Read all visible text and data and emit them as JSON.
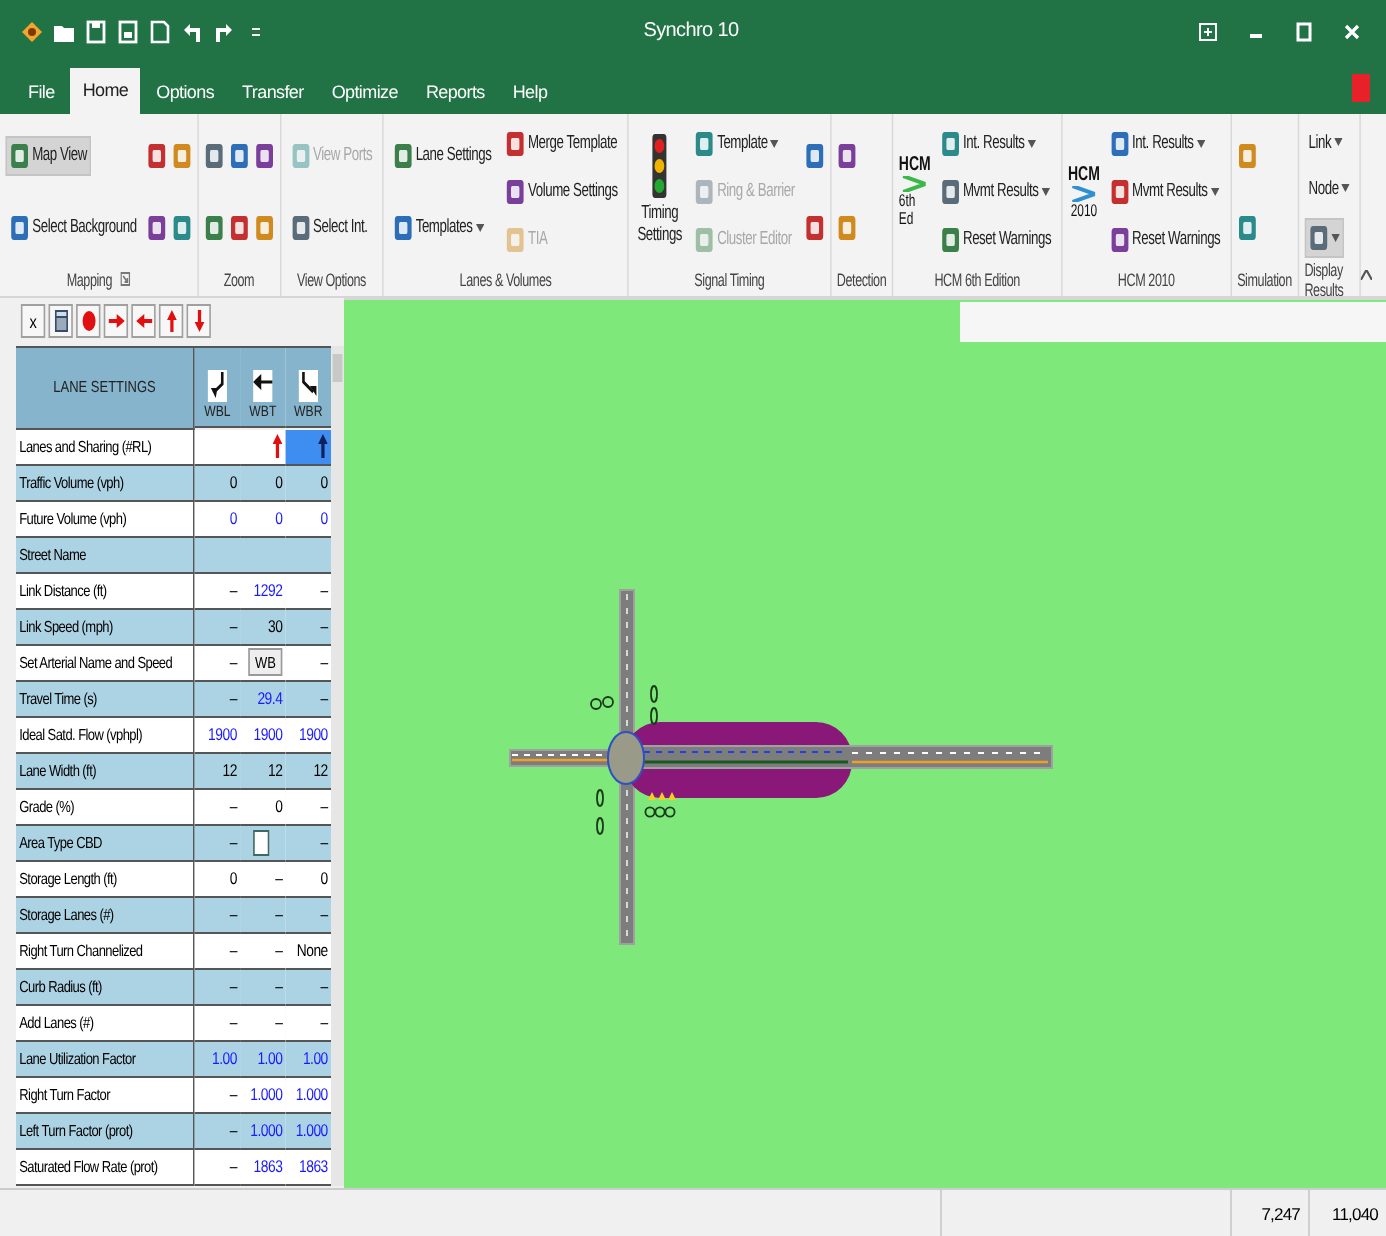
{
  "window": {
    "title": "Synchro 10"
  },
  "tabs": [
    {
      "label": "File",
      "selected": false
    },
    {
      "label": "Home",
      "selected": true
    },
    {
      "label": "Options",
      "selected": false
    },
    {
      "label": "Transfer",
      "selected": false
    },
    {
      "label": "Optimize",
      "selected": false
    },
    {
      "label": "Reports",
      "selected": false
    },
    {
      "label": "Help",
      "selected": false
    }
  ],
  "ribbon": {
    "groups": [
      {
        "label": "Mapping",
        "launcher": true,
        "columns": [
          [
            {
              "kind": "toggle",
              "label": "Map View",
              "active": true,
              "disabled": false
            },
            {
              "kind": "button",
              "label": "Select Background",
              "disabled": false
            }
          ],
          [
            {
              "kind": "icon"
            },
            {
              "kind": "icon"
            }
          ],
          [
            {
              "kind": "icon"
            },
            {
              "kind": "icon"
            }
          ]
        ]
      },
      {
        "label": "Zoom",
        "columns": [
          [
            {
              "kind": "icon"
            },
            {
              "kind": "icon"
            }
          ],
          [
            {
              "kind": "icon"
            },
            {
              "kind": "icon"
            }
          ],
          [
            {
              "kind": "icon"
            },
            {
              "kind": "icon"
            }
          ]
        ]
      },
      {
        "label": "View Options",
        "columns": [
          [
            {
              "kind": "button",
              "label": "View Ports",
              "disabled": true
            },
            {
              "kind": "button",
              "label": "Select Int.",
              "disabled": false
            }
          ]
        ]
      },
      {
        "label": "Lanes & Volumes",
        "columns": [
          [
            {
              "kind": "button",
              "label": "Lane Settings",
              "disabled": false
            },
            {
              "kind": "button",
              "label": "Templates",
              "disabled": false,
              "dropdown": true
            }
          ],
          [
            {
              "kind": "button",
              "label": "Merge Template",
              "disabled": false
            },
            {
              "kind": "button",
              "label": "Volume Settings",
              "disabled": false
            },
            {
              "kind": "button",
              "label": "TIA",
              "disabled": true
            }
          ]
        ]
      },
      {
        "label": "Signal Timing",
        "columns": [
          [
            {
              "kind": "large",
              "label": "Timing Settings"
            }
          ],
          [
            {
              "kind": "button",
              "label": "Template",
              "disabled": false,
              "dropdown": true
            },
            {
              "kind": "button",
              "label": "Ring & Barrier",
              "disabled": true
            },
            {
              "kind": "button",
              "label": "Cluster Editor",
              "disabled": true
            }
          ],
          [
            {
              "kind": "icon"
            },
            {
              "kind": "icon"
            }
          ]
        ]
      },
      {
        "label": "Detection",
        "columns": [
          [
            {
              "kind": "icon"
            },
            {
              "kind": "icon"
            }
          ]
        ]
      },
      {
        "label": "HCM 6th Edition",
        "columns": [
          [
            {
              "kind": "logo",
              "lines": [
                "HCM",
                "6th Ed"
              ]
            }
          ],
          [
            {
              "kind": "button",
              "label": "Int. Results",
              "disabled": false,
              "dropdown": true
            },
            {
              "kind": "button",
              "label": "Mvmt Results",
              "disabled": false,
              "dropdown": true
            },
            {
              "kind": "button",
              "label": "Reset Warnings",
              "disabled": false
            }
          ]
        ]
      },
      {
        "label": "HCM 2010",
        "columns": [
          [
            {
              "kind": "logo",
              "lines": [
                "HCM",
                "2010"
              ]
            }
          ],
          [
            {
              "kind": "button",
              "label": "Int. Results",
              "disabled": false,
              "dropdown": true
            },
            {
              "kind": "button",
              "label": "Mvmt Results",
              "disabled": false,
              "dropdown": true
            },
            {
              "kind": "button",
              "label": "Reset Warnings",
              "disabled": false
            }
          ]
        ]
      },
      {
        "label": "Simulation",
        "columns": [
          [
            {
              "kind": "icon"
            },
            {
              "kind": "icon"
            }
          ]
        ]
      },
      {
        "label": "Display Results",
        "columns": [
          [
            {
              "kind": "menu",
              "label": "Link",
              "dropdown": true
            },
            {
              "kind": "menu",
              "label": "Node",
              "dropdown": true
            },
            {
              "kind": "toggle",
              "active": true,
              "dropdown": true
            }
          ]
        ]
      }
    ]
  },
  "lane_panel": {
    "toolbar": [
      {
        "kind": "text",
        "label": "x"
      },
      {
        "kind": "icon"
      },
      {
        "kind": "icon"
      },
      {
        "kind": "icon"
      },
      {
        "kind": "icon"
      },
      {
        "kind": "icon"
      },
      {
        "kind": "icon"
      }
    ],
    "title": "LANE SETTINGS",
    "columns": [
      {
        "label": "WBL"
      },
      {
        "label": "WBT"
      },
      {
        "label": "WBR"
      }
    ],
    "rows": [
      {
        "label": "Lanes and Sharing (#RL)",
        "cells": [
          {
            "kind": "empty",
            "selected": false
          },
          {
            "kind": "lanes",
            "selected": false
          },
          {
            "kind": "lanes",
            "selected": true
          }
        ]
      },
      {
        "label": "Traffic Volume (vph)",
        "cells": [
          {
            "kind": "text",
            "text": "0",
            "color": "#000000"
          },
          {
            "kind": "text",
            "text": "0",
            "color": "#000000"
          },
          {
            "kind": "text",
            "text": "0",
            "color": "#000000"
          }
        ]
      },
      {
        "label": "Future Volume (vph)",
        "cells": [
          {
            "kind": "text",
            "text": "0",
            "color": "#1a1aff"
          },
          {
            "kind": "text",
            "text": "0",
            "color": "#1a1aff"
          },
          {
            "kind": "text",
            "text": "0",
            "color": "#1a1aff"
          }
        ]
      },
      {
        "label": "Street Name"
      },
      {
        "label": "Link Distance (ft)",
        "cells": [
          {
            "kind": "text",
            "text": "–"
          },
          {
            "kind": "text",
            "text": "1292",
            "color": "#1a1aff"
          },
          {
            "kind": "text",
            "text": "–"
          }
        ]
      },
      {
        "label": "Link Speed (mph)",
        "cells": [
          {
            "kind": "text",
            "text": "–"
          },
          {
            "kind": "text",
            "text": "30",
            "color": "#000000"
          },
          {
            "kind": "text",
            "text": "–"
          }
        ]
      },
      {
        "label": "Set Arterial Name and Speed",
        "cells": [
          {
            "kind": "text",
            "text": "–"
          },
          {
            "kind": "button",
            "text": "WB"
          },
          {
            "kind": "text",
            "text": "–"
          }
        ]
      },
      {
        "label": "Travel Time (s)",
        "cells": [
          {
            "kind": "text",
            "text": "–"
          },
          {
            "kind": "text",
            "text": "29.4",
            "color": "#1a1aff"
          },
          {
            "kind": "text",
            "text": "–"
          }
        ]
      },
      {
        "label": "Ideal Satd. Flow (vphpl)",
        "cells": [
          {
            "kind": "text",
            "text": "1900",
            "color": "#1a1aff"
          },
          {
            "kind": "text",
            "text": "1900",
            "color": "#1a1aff"
          },
          {
            "kind": "text",
            "text": "1900",
            "color": "#1a1aff"
          }
        ]
      },
      {
        "label": "Lane Width (ft)",
        "cells": [
          {
            "kind": "text",
            "text": "12",
            "color": "#000000"
          },
          {
            "kind": "text",
            "text": "12",
            "color": "#000000"
          },
          {
            "kind": "text",
            "text": "12",
            "color": "#000000"
          }
        ]
      },
      {
        "label": "Grade (%)",
        "cells": [
          {
            "kind": "text",
            "text": "–"
          },
          {
            "kind": "text",
            "text": "0",
            "color": "#000000"
          },
          {
            "kind": "text",
            "text": "–"
          }
        ]
      },
      {
        "label": "Area Type CBD",
        "cells": [
          {
            "kind": "text",
            "text": "–"
          },
          {
            "kind": "checkbox",
            "checked": false
          },
          {
            "kind": "text",
            "text": "–"
          }
        ]
      },
      {
        "label": "Storage Length (ft)",
        "cells": [
          {
            "kind": "text",
            "text": "0",
            "color": "#000000"
          },
          {
            "kind": "text",
            "text": "–"
          },
          {
            "kind": "text",
            "text": "0",
            "color": "#000000"
          }
        ]
      },
      {
        "label": "Storage Lanes (#)",
        "cells": [
          {
            "kind": "text",
            "text": "–"
          },
          {
            "kind": "text",
            "text": "–"
          },
          {
            "kind": "text",
            "text": "–"
          }
        ]
      },
      {
        "label": "Right Turn Channelized",
        "cells": [
          {
            "kind": "text",
            "text": "–"
          },
          {
            "kind": "text",
            "text": "–"
          },
          {
            "kind": "text",
            "text": "None",
            "color": "#000000"
          }
        ]
      },
      {
        "label": "Curb Radius (ft)",
        "cells": [
          {
            "kind": "text",
            "text": "–"
          },
          {
            "kind": "text",
            "text": "–"
          },
          {
            "kind": "text",
            "text": "–"
          }
        ]
      },
      {
        "label": "Add Lanes (#)",
        "cells": [
          {
            "kind": "text",
            "text": "–"
          },
          {
            "kind": "text",
            "text": "–"
          },
          {
            "kind": "text",
            "text": "–"
          }
        ]
      },
      {
        "label": "Lane Utilization Factor",
        "cells": [
          {
            "kind": "text",
            "text": "1.00",
            "color": "#1a1aff"
          },
          {
            "kind": "text",
            "text": "1.00",
            "color": "#1a1aff"
          },
          {
            "kind": "text",
            "text": "1.00",
            "color": "#1a1aff"
          }
        ]
      },
      {
        "label": "Right Turn Factor",
        "cells": [
          {
            "kind": "text",
            "text": "–"
          },
          {
            "kind": "text",
            "text": "1.000",
            "color": "#1a1aff"
          },
          {
            "kind": "text",
            "text": "1.000",
            "color": "#1a1aff"
          }
        ]
      },
      {
        "label": "Left Turn Factor (prot)",
        "cells": [
          {
            "kind": "text",
            "text": "–"
          },
          {
            "kind": "text",
            "text": "1.000",
            "color": "#1a1aff"
          },
          {
            "kind": "text",
            "text": "1.000",
            "color": "#1a1aff"
          }
        ]
      },
      {
        "label": "Saturated Flow Rate (prot)",
        "cells": [
          {
            "kind": "text",
            "text": "–"
          },
          {
            "kind": "text",
            "text": "1863",
            "color": "#1a1aff"
          },
          {
            "kind": "text",
            "text": "1863",
            "color": "#1a1aff"
          }
        ]
      }
    ]
  },
  "status_bar": {
    "cells": [
      "7,247",
      "11,040"
    ]
  }
}
